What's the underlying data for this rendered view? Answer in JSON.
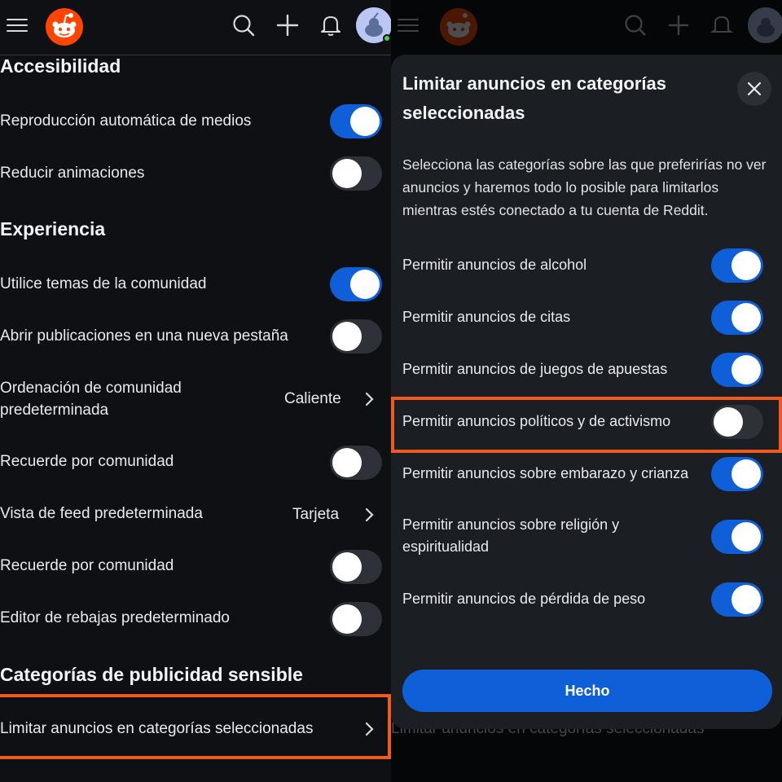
{
  "left": {
    "sections": [
      {
        "title": "Accesibilidad"
      },
      {
        "title": "Experiencia"
      },
      {
        "title": "Categorías de publicidad sensible"
      }
    ],
    "rows": [
      {
        "label": "Reproducción automática de medios",
        "toggle": "on"
      },
      {
        "label": "Reducir animaciones",
        "toggle": "off"
      },
      {
        "label": "Utilice temas de la comunidad",
        "toggle": "on"
      },
      {
        "label": "Abrir publicaciones en una nueva pestaña",
        "toggle": "off"
      },
      {
        "label": "Ordenación de comunidad predeterminada",
        "value": "Caliente"
      },
      {
        "label": "Recuerde por comunidad",
        "toggle": "off"
      },
      {
        "label": "Vista de feed predeterminada",
        "value": "Tarjeta"
      },
      {
        "label": "Recuerde por comunidad",
        "toggle": "off"
      },
      {
        "label": "Editor de rebajas predeterminado",
        "toggle": "off"
      },
      {
        "label": "Limitar anuncios en categorías seleccionadas"
      }
    ]
  },
  "sheet": {
    "title": "Limitar anuncios en categorías seleccionadas",
    "description": "Selecciona las categorías sobre las que preferirías no ver anuncios y haremos todo lo posible para limitarlos mientras estés conectado a tu cuenta de Reddit.",
    "options": [
      {
        "label": "Permitir anuncios de alcohol",
        "enabled": true
      },
      {
        "label": "Permitir anuncios de citas",
        "enabled": true
      },
      {
        "label": "Permitir anuncios de juegos de apuestas",
        "enabled": true
      },
      {
        "label": "Permitir anuncios políticos y de activismo",
        "enabled": false
      },
      {
        "label": "Permitir anuncios sobre embarazo y crianza",
        "enabled": true
      },
      {
        "label": "Permitir anuncios sobre religión y espiritualidad",
        "enabled": true
      },
      {
        "label": "Permitir anuncios de pérdida de peso",
        "enabled": true
      }
    ],
    "done_label": "Hecho",
    "behind_text": "Limitar anuncios en categorías seleccionadas"
  },
  "icons": {
    "menu": "hamburger-menu-icon",
    "logo": "reddit-logo",
    "search": "search-icon",
    "create": "plus-icon",
    "notifications": "bell-icon",
    "avatar": "user-avatar",
    "close": "close-icon",
    "chevron": "chevron-right-icon"
  },
  "colors": {
    "accent": "#0f5fd8",
    "brand": "#ff4500",
    "highlight": "#f05a1e",
    "background": "#0e1014",
    "sheet": "#1b1e22"
  }
}
